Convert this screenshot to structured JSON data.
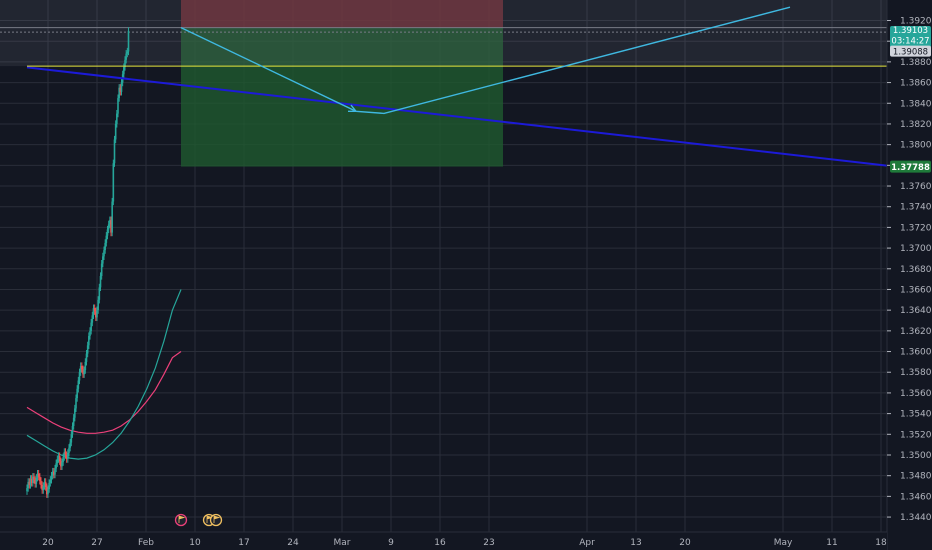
{
  "chart_data": {
    "type": "candlestick",
    "y_axis": {
      "range": [
        1.3428,
        1.3932
      ],
      "tick_labels": [
        "1.39200",
        "1.39000",
        "1.38800",
        "1.38600",
        "1.38400",
        "1.38200",
        "1.38000",
        "1.37800",
        "1.37600",
        "1.37400",
        "1.37200",
        "1.37000",
        "1.36800",
        "1.36600",
        "1.36400",
        "1.36200",
        "1.36000",
        "1.35800",
        "1.35600",
        "1.35400",
        "1.35200",
        "1.35000",
        "1.34800",
        "1.34600",
        "1.34400"
      ],
      "tick_values": [
        1.392,
        1.39,
        1.388,
        1.386,
        1.384,
        1.382,
        1.38,
        1.378,
        1.376,
        1.374,
        1.372,
        1.37,
        1.368,
        1.366,
        1.364,
        1.362,
        1.36,
        1.358,
        1.356,
        1.354,
        1.352,
        1.35,
        1.348,
        1.346,
        1.344
      ],
      "position": "right"
    },
    "x_axis": {
      "range": [
        "2020-01-17",
        "2020-05-20"
      ],
      "tick_labels": [
        "20",
        "27",
        "Feb",
        "10",
        "17",
        "24",
        "Mar",
        "9",
        "16",
        "23",
        "Apr",
        "13",
        "20",
        "May",
        "11",
        "18"
      ],
      "tick_dates": [
        "2020-01-20",
        "2020-01-27",
        "2020-02-03",
        "2020-02-10",
        "2020-02-17",
        "2020-02-24",
        "2020-03-02",
        "2020-03-09",
        "2020-03-16",
        "2020-03-23",
        "2020-04-06",
        "2020-04-13",
        "2020-04-20",
        "2020-05-04",
        "2020-05-11",
        "2020-05-18"
      ]
    },
    "price_labels": {
      "current_price": "1.39103",
      "countdown": "03:14:27",
      "line_price": "1.39088",
      "support_price": "1.37788"
    },
    "candles": {
      "start_date": "2020-01-17",
      "interval_hours": 4,
      "closes": [
        1.3468,
        1.3474,
        1.3471,
        1.3477,
        1.3473,
        1.3479,
        1.3476,
        1.3472,
        1.3478,
        1.3482,
        1.3479,
        1.3475,
        1.3471,
        1.3466,
        1.347,
        1.3474,
        1.3469,
        1.3462,
        1.3467,
        1.3473,
        1.3476,
        1.348,
        1.3484,
        1.3481,
        1.3487,
        1.3492,
        1.3496,
        1.3499,
        1.3494,
        1.3489,
        1.3493,
        1.3498,
        1.3503,
        1.35,
        1.3496,
        1.3502,
        1.3507,
        1.3512,
        1.352,
        1.3528,
        1.3536,
        1.3545,
        1.3555,
        1.3564,
        1.3572,
        1.358,
        1.3586,
        1.3583,
        1.3578,
        1.3582,
        1.359,
        1.3598,
        1.3606,
        1.3615,
        1.362,
        1.3628,
        1.3635,
        1.3642,
        1.3639,
        1.3633,
        1.364,
        1.365,
        1.3662,
        1.3673,
        1.3685,
        1.3692,
        1.3698,
        1.3705,
        1.3712,
        1.3718,
        1.3723,
        1.3727,
        1.3715,
        1.3745,
        1.3782,
        1.3805,
        1.382,
        1.383,
        1.3845,
        1.3855,
        1.3851,
        1.386,
        1.3868,
        1.3875,
        1.3882,
        1.3888,
        1.389,
        1.391
      ]
    },
    "moving_averages": [
      {
        "color": "#ec407a",
        "start_date": "2020-01-17",
        "end_date": "2020-02-08",
        "values": [
          1.3546,
          1.3541,
          1.3536,
          1.3531,
          1.3527,
          1.3524,
          1.3522,
          1.3521,
          1.3521,
          1.3522,
          1.3524,
          1.3528,
          1.3534,
          1.3542,
          1.3552,
          1.3563,
          1.3578,
          1.3594,
          1.36
        ]
      },
      {
        "color": "#26a69a",
        "start_date": "2020-01-17",
        "end_date": "2020-02-08",
        "values": [
          1.3519,
          1.3514,
          1.3509,
          1.3504,
          1.35,
          1.3497,
          1.3496,
          1.3497,
          1.35,
          1.3505,
          1.3512,
          1.3521,
          1.3533,
          1.3547,
          1.3564,
          1.3584,
          1.361,
          1.364,
          1.366
        ]
      }
    ],
    "trendlines": [
      {
        "name": "blue-trendline",
        "color": "#1c1ad8",
        "points": [
          [
            "2020-01-17",
            1.38747
          ],
          [
            "2020-05-20",
            1.37788
          ]
        ]
      },
      {
        "name": "yellow-level",
        "color": "#e6e63c",
        "points": [
          [
            "2020-01-17",
            1.38759
          ],
          [
            "2020-05-20",
            1.38759
          ]
        ]
      },
      {
        "name": "projection-path",
        "color": "#3fb8e0",
        "points": [
          [
            "2020-02-08",
            1.39131
          ],
          [
            "2020-03-04",
            1.38322
          ],
          [
            "2020-03-08",
            1.38302
          ],
          [
            "2020-05-05",
            1.39329
          ]
        ]
      }
    ],
    "position_tool": {
      "start_date": "2020-02-08",
      "end_date": "2020-03-25",
      "entry": 1.39131,
      "stop": 1.39432,
      "target": 1.37788,
      "stop_color": "#6b2a33",
      "target_color": "#1f5a30"
    },
    "colors": {
      "background": "#131722",
      "grid": "#2a2e39",
      "up": "#26a69a",
      "down": "#ef5350",
      "axis_text": "#b2b5be"
    },
    "grid": true,
    "legend": "none"
  },
  "event_markers": {
    "glyph": "flag-icon",
    "colors": [
      "#f0c060",
      "#ec407a"
    ]
  }
}
